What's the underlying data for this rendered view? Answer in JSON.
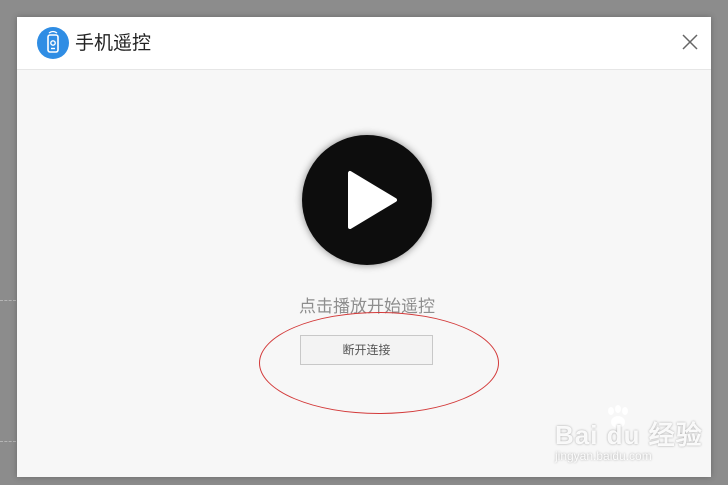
{
  "dialog": {
    "title": "手机遥控",
    "app_icon": "remote-control-icon",
    "close_icon": "close-icon"
  },
  "player": {
    "play_icon": "play-icon",
    "hint": "点击播放开始遥控"
  },
  "actions": {
    "disconnect_label": "断开连接"
  },
  "watermark": {
    "brand": "Bai du 经验",
    "url": "jingyan.baidu.com"
  },
  "colors": {
    "app_icon_bg": "#2f8de4",
    "annotation_ellipse": "#d33a3a",
    "play_button_bg": "#0d0d0d"
  }
}
